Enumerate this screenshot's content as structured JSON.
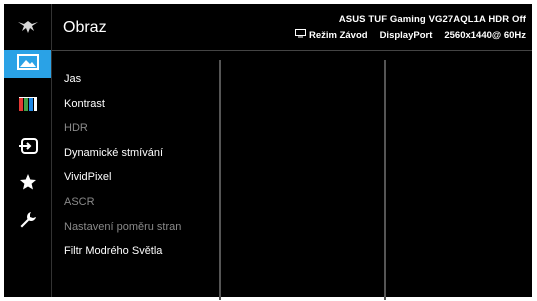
{
  "header": {
    "title": "Obraz",
    "model": "ASUS TUF Gaming  VG27AQL1A HDR Off",
    "mode": "Režim Závod",
    "input": "DisplayPort",
    "resolution": "2560x1440@ 60Hz"
  },
  "sidebar": {
    "items": [
      {
        "icon": "image-icon",
        "active": true
      },
      {
        "icon": "color-bars-icon",
        "active": false
      },
      {
        "icon": "input-source-icon",
        "active": false
      },
      {
        "icon": "star-icon",
        "active": false
      },
      {
        "icon": "wrench-icon",
        "active": false
      }
    ],
    "accent_color": "#2aa2e6"
  },
  "menu": {
    "items": [
      {
        "label": "Jas",
        "enabled": true
      },
      {
        "label": "Kontrast",
        "enabled": true
      },
      {
        "label": "HDR",
        "enabled": false
      },
      {
        "label": "Dynamické stmívání",
        "enabled": true
      },
      {
        "label": "VividPixel",
        "enabled": true
      },
      {
        "label": "ASCR",
        "enabled": false
      },
      {
        "label": "Nastavení poměru stran",
        "enabled": false
      },
      {
        "label": "Filtr Modrého Světla",
        "enabled": true
      }
    ]
  }
}
